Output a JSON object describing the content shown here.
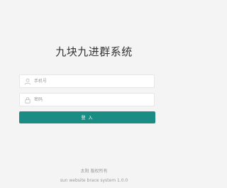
{
  "title": "九块九进群系统",
  "form": {
    "phone_placeholder": "手机号",
    "password_placeholder": "密码",
    "login_label": "登 入"
  },
  "footer": {
    "copyright": "太阳 版权所有",
    "system_version": "sun website brace system 1.0.0"
  },
  "colors": {
    "primary": "#1a8c84",
    "background": "#f4f4f4"
  }
}
